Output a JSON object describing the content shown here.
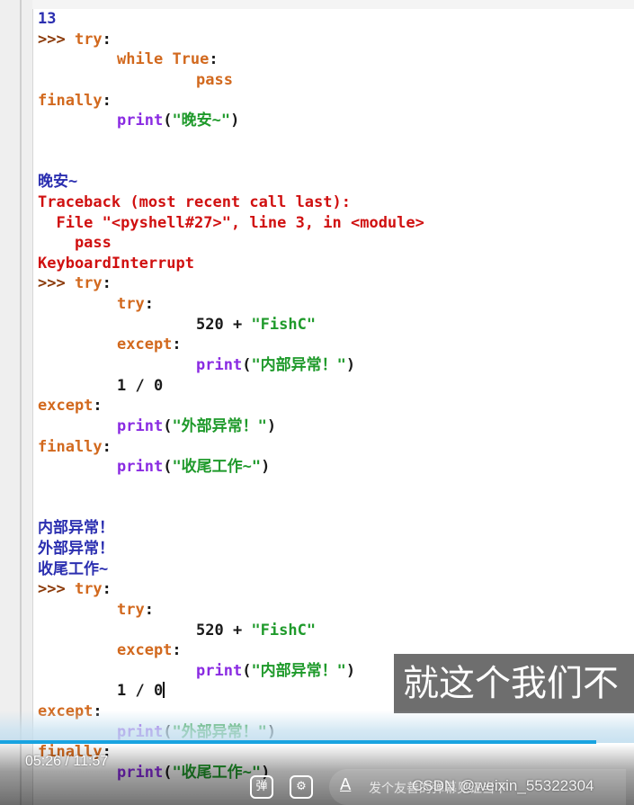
{
  "shell": {
    "lines": [
      {
        "indent": 0,
        "tokens": [
          {
            "t": "13",
            "c": "out"
          }
        ]
      },
      {
        "indent": 0,
        "tokens": [
          {
            "t": ">>> ",
            "c": "prompt"
          },
          {
            "t": "try",
            "c": "kw"
          },
          {
            "t": ":",
            "c": "plain"
          }
        ]
      },
      {
        "indent": 1,
        "tokens": [
          {
            "t": "while",
            "c": "kw"
          },
          {
            "t": " ",
            "c": "plain"
          },
          {
            "t": "True",
            "c": "kw"
          },
          {
            "t": ":",
            "c": "plain"
          }
        ]
      },
      {
        "indent": 2,
        "tokens": [
          {
            "t": "pass",
            "c": "kw"
          }
        ]
      },
      {
        "indent": 0,
        "tokens": [
          {
            "t": "finally",
            "c": "kw"
          },
          {
            "t": ":",
            "c": "plain"
          }
        ]
      },
      {
        "indent": 1,
        "tokens": [
          {
            "t": "print",
            "c": "builtin"
          },
          {
            "t": "(",
            "c": "plain"
          },
          {
            "t": "\"晚安~\"",
            "c": "str"
          },
          {
            "t": ")",
            "c": "plain"
          }
        ]
      },
      {
        "indent": 0,
        "tokens": []
      },
      {
        "indent": 0,
        "tokens": []
      },
      {
        "indent": 0,
        "tokens": [
          {
            "t": "晚安~",
            "c": "out"
          }
        ]
      },
      {
        "indent": 0,
        "tokens": [
          {
            "t": "Traceback (most recent call last):",
            "c": "err"
          }
        ]
      },
      {
        "indent": 0,
        "tokens": [
          {
            "t": "  File \"<pyshell#27>\", line 3, in <module>",
            "c": "err"
          }
        ]
      },
      {
        "indent": 0,
        "tokens": [
          {
            "t": "    pass",
            "c": "err"
          }
        ]
      },
      {
        "indent": 0,
        "tokens": [
          {
            "t": "KeyboardInterrupt",
            "c": "err"
          }
        ]
      },
      {
        "indent": 0,
        "tokens": [
          {
            "t": ">>> ",
            "c": "prompt"
          },
          {
            "t": "try",
            "c": "kw"
          },
          {
            "t": ":",
            "c": "plain"
          }
        ]
      },
      {
        "indent": 1,
        "tokens": [
          {
            "t": "try",
            "c": "kw"
          },
          {
            "t": ":",
            "c": "plain"
          }
        ]
      },
      {
        "indent": 2,
        "tokens": [
          {
            "t": "520 + ",
            "c": "plain"
          },
          {
            "t": "\"FishC\"",
            "c": "str"
          }
        ]
      },
      {
        "indent": 1,
        "tokens": [
          {
            "t": "except",
            "c": "kw"
          },
          {
            "t": ":",
            "c": "plain"
          }
        ]
      },
      {
        "indent": 2,
        "tokens": [
          {
            "t": "print",
            "c": "builtin"
          },
          {
            "t": "(",
            "c": "plain"
          },
          {
            "t": "\"内部异常！\"",
            "c": "str"
          },
          {
            "t": ")",
            "c": "plain"
          }
        ]
      },
      {
        "indent": 1,
        "tokens": [
          {
            "t": "1 / 0",
            "c": "plain"
          }
        ]
      },
      {
        "indent": 0,
        "tokens": [
          {
            "t": "except",
            "c": "kw"
          },
          {
            "t": ":",
            "c": "plain"
          }
        ]
      },
      {
        "indent": 1,
        "tokens": [
          {
            "t": "print",
            "c": "builtin"
          },
          {
            "t": "(",
            "c": "plain"
          },
          {
            "t": "\"外部异常！\"",
            "c": "str"
          },
          {
            "t": ")",
            "c": "plain"
          }
        ]
      },
      {
        "indent": 0,
        "tokens": [
          {
            "t": "finally",
            "c": "kw"
          },
          {
            "t": ":",
            "c": "plain"
          }
        ]
      },
      {
        "indent": 1,
        "tokens": [
          {
            "t": "print",
            "c": "builtin"
          },
          {
            "t": "(",
            "c": "plain"
          },
          {
            "t": "\"收尾工作~\"",
            "c": "str"
          },
          {
            "t": ")",
            "c": "plain"
          }
        ]
      },
      {
        "indent": 0,
        "tokens": []
      },
      {
        "indent": 0,
        "tokens": []
      },
      {
        "indent": 0,
        "tokens": [
          {
            "t": "内部异常！",
            "c": "out"
          }
        ]
      },
      {
        "indent": 0,
        "tokens": [
          {
            "t": "外部异常！",
            "c": "out"
          }
        ]
      },
      {
        "indent": 0,
        "tokens": [
          {
            "t": "收尾工作~",
            "c": "out"
          }
        ]
      },
      {
        "indent": 0,
        "tokens": [
          {
            "t": ">>> ",
            "c": "prompt"
          },
          {
            "t": "try",
            "c": "kw"
          },
          {
            "t": ":",
            "c": "plain"
          }
        ]
      },
      {
        "indent": 1,
        "tokens": [
          {
            "t": "try",
            "c": "kw"
          },
          {
            "t": ":",
            "c": "plain"
          }
        ]
      },
      {
        "indent": 2,
        "tokens": [
          {
            "t": "520 + ",
            "c": "plain"
          },
          {
            "t": "\"FishC\"",
            "c": "str"
          }
        ]
      },
      {
        "indent": 1,
        "tokens": [
          {
            "t": "except",
            "c": "kw"
          },
          {
            "t": ":",
            "c": "plain"
          }
        ]
      },
      {
        "indent": 2,
        "tokens": [
          {
            "t": "print",
            "c": "builtin"
          },
          {
            "t": "(",
            "c": "plain"
          },
          {
            "t": "\"内部异常！\"",
            "c": "str"
          },
          {
            "t": ")",
            "c": "plain"
          }
        ]
      },
      {
        "indent": 1,
        "tokens": [
          {
            "t": "1 / 0",
            "c": "plain"
          }
        ],
        "caret": true
      },
      {
        "indent": 0,
        "tokens": [
          {
            "t": "except",
            "c": "kw"
          },
          {
            "t": ":",
            "c": "plain"
          }
        ]
      },
      {
        "indent": 1,
        "tokens": [
          {
            "t": "print",
            "c": "builtin"
          },
          {
            "t": "(",
            "c": "plain"
          },
          {
            "t": "\"外部异常！\"",
            "c": "str"
          },
          {
            "t": ")",
            "c": "plain"
          }
        ]
      },
      {
        "indent": 0,
        "tokens": [
          {
            "t": "finally",
            "c": "kw"
          },
          {
            "t": ":",
            "c": "plain"
          }
        ]
      },
      {
        "indent": 1,
        "tokens": [
          {
            "t": "print",
            "c": "builtin"
          },
          {
            "t": "(",
            "c": "plain"
          },
          {
            "t": "\"收尾工作~\"",
            "c": "str"
          },
          {
            "t": ")",
            "c": "plain"
          }
        ]
      }
    ]
  },
  "colors": {
    "prompt": "#8b3a0a",
    "keyword": "#d2691e",
    "builtin": "#8a2be2",
    "string": "#1f9a2b",
    "output": "#2b2fb0",
    "error": "#d01010",
    "progress": "#19a3e0"
  },
  "subtitle": {
    "text": "就这个我们不"
  },
  "player": {
    "current_time": "05:26",
    "separator": "/",
    "duration": "11:57",
    "progress_fraction": 0.455,
    "danmaku_icon_label": "弹",
    "danmaku_settings_icon": "danmaku-settings-icon",
    "danmaku_style_glyph": "A",
    "danmaku_placeholder": "发个友善的弹幕见证当下",
    "watermark": "CSDN @weixin_55322304"
  }
}
